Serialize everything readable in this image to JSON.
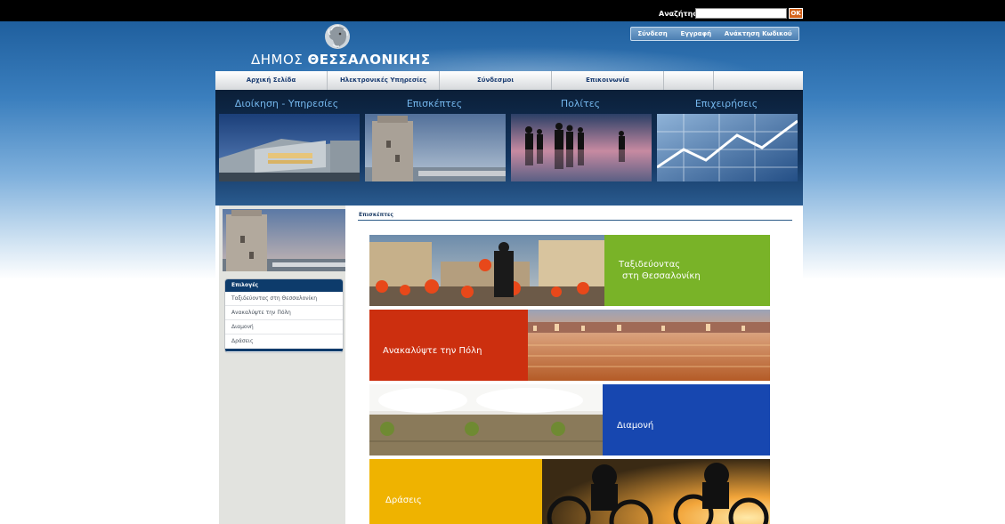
{
  "search": {
    "label": "Αναζήτηση",
    "placeholder": "",
    "button": "OK"
  },
  "account": {
    "login": "Σύνδεση",
    "register": "Εγγραφή",
    "recover": "Ανάκτηση Κωδικού"
  },
  "logo": {
    "part1": "ΔΗΜΟΣ ",
    "part2": "ΘΕΣΣΑΛΟΝΙΚΗΣ"
  },
  "nav": {
    "items": [
      "Αρχική Σελίδα",
      "Ηλεκτρονικές Υπηρεσίες",
      "Σύνδεσμοι",
      "Επικοινωνία"
    ]
  },
  "categories": [
    {
      "label": "Διοίκηση - Υπηρεσίες"
    },
    {
      "label": "Επισκέπτες"
    },
    {
      "label": "Πολίτες"
    },
    {
      "label": "Επιχειρήσεις"
    }
  ],
  "sidebar": {
    "menu_title": "Επιλογές",
    "items": [
      "Ταξιδεύοντας στη Θεσσαλονίκη",
      "Ανακαλύψτε την Πόλη",
      "Διαμονή",
      "Δράσεις"
    ]
  },
  "content": {
    "heading": "Επισκέπτες",
    "tiles": [
      {
        "line1": "Ταξιδεύοντας",
        "line2": "στη Θεσσαλονίκη",
        "color": "#79b328"
      },
      {
        "line1": "Ανακαλύψτε την Πόλη",
        "line2": "",
        "color": "#cc2f0f"
      },
      {
        "line1": "Διαμονή",
        "line2": "",
        "color": "#1747b0"
      },
      {
        "line1": "Δράσεις",
        "line2": "",
        "color": "#efb300"
      }
    ]
  },
  "colors": {
    "accent": "#0d3b6b",
    "ok_button": "#d4621a",
    "nav_text": "#1b3d72"
  }
}
